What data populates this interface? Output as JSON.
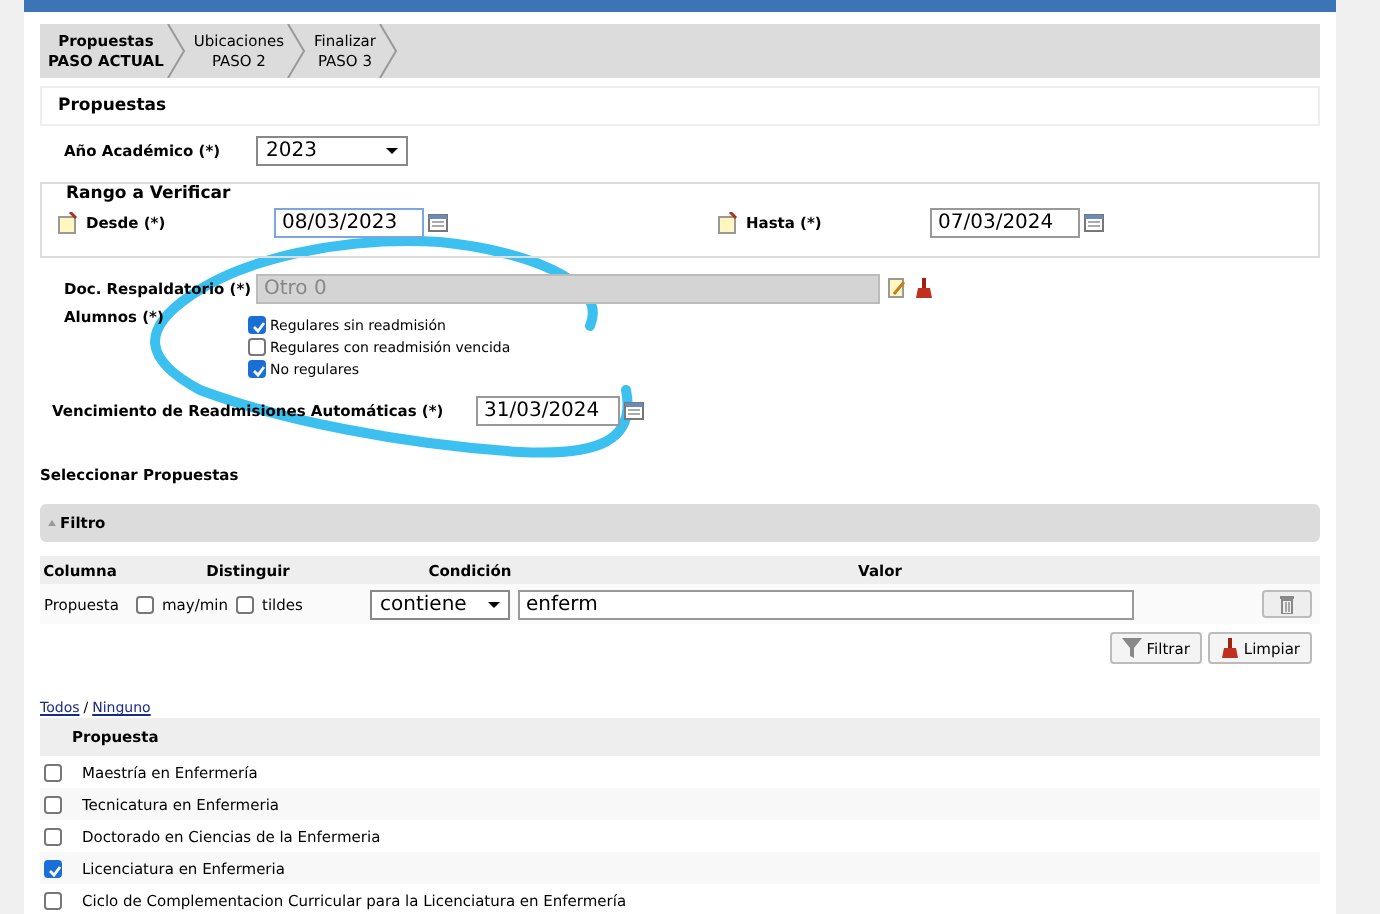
{
  "steps": [
    {
      "label": "Propuestas",
      "sub": "PASO ACTUAL",
      "selected": true
    },
    {
      "label": "Ubicaciones",
      "sub": "PASO 2",
      "selected": false
    },
    {
      "label": "Finalizar",
      "sub": "PASO 3",
      "selected": false
    }
  ],
  "section_title": "Propuestas",
  "year": {
    "label": "Año Académico (*)",
    "value": "2023"
  },
  "range": {
    "legend": "Rango a Verificar",
    "from_label": "Desde (*)",
    "from_value": "08/03/2023",
    "to_label": "Hasta (*)",
    "to_value": "07/03/2024"
  },
  "document": {
    "label": "Doc. Respaldatorio (*)",
    "value": "Otro 0",
    "disabled": true
  },
  "students": {
    "label": "Alumnos (*)",
    "options": [
      {
        "label": "Regulares sin readmisión",
        "checked": true
      },
      {
        "label": "Regulares con readmisión vencida",
        "checked": false
      },
      {
        "label": "No regulares",
        "checked": true
      }
    ]
  },
  "expiry": {
    "label": "Vencimiento de Readmisiones Automáticas (*)",
    "value": "31/03/2024"
  },
  "select_title": "Seleccionar Propuestas",
  "filter": {
    "title": "Filtro",
    "expanded": true,
    "columns": [
      "Columna",
      "Distinguir",
      "Condición",
      "Valor"
    ],
    "row": {
      "column": "Propuesta",
      "case_label": "may/min",
      "case_checked": false,
      "accent_label": "tildes",
      "accent_checked": false,
      "condition": "contiene",
      "value": "enferm"
    },
    "buttons": [
      "Filtrar",
      "Limpiar"
    ]
  },
  "links": [
    "Todos",
    "Ninguno"
  ],
  "links_separator": "/",
  "table": {
    "column": "Propuesta",
    "rows": [
      {
        "name": "Maestría en Enfermería",
        "checked": false
      },
      {
        "name": "Tecnicatura en Enfermeria",
        "checked": false
      },
      {
        "name": "Doctorado en Ciencias de la Enfermeria",
        "checked": false
      },
      {
        "name": "Licenciatura en Enfermeria",
        "checked": true
      },
      {
        "name": "Ciclo de Complementacion Curricular para la Licenciatura en Enfermería",
        "checked": false
      }
    ]
  }
}
